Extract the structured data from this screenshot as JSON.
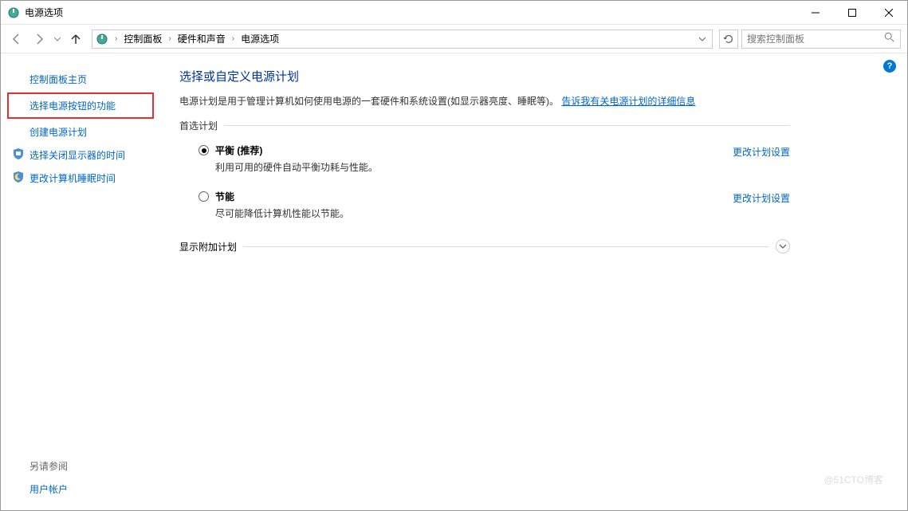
{
  "window": {
    "title": "电源选项"
  },
  "breadcrumb": {
    "items": [
      "控制面板",
      "硬件和声音",
      "电源选项"
    ]
  },
  "search": {
    "placeholder": "搜索控制面板"
  },
  "sidebar": {
    "items": [
      {
        "label": "控制面板主页",
        "icon": null,
        "highlighted": false
      },
      {
        "label": "选择电源按钮的功能",
        "icon": null,
        "highlighted": true
      },
      {
        "label": "创建电源计划",
        "icon": null,
        "highlighted": false
      },
      {
        "label": "选择关闭显示器的时间",
        "icon": "monitor",
        "highlighted": false
      },
      {
        "label": "更改计算机睡眠时间",
        "icon": "moon",
        "highlighted": false
      }
    ],
    "footer_label": "另请参阅",
    "footer_link": "用户帐户"
  },
  "main": {
    "heading": "选择或自定义电源计划",
    "desc_text": "电源计划是用于管理计算机如何使用电源的一套硬件和系统设置(如显示器亮度、睡眠等)。",
    "desc_link": "告诉我有关电源计划的详细信息",
    "preferred_label": "首选计划",
    "plans": [
      {
        "title": "平衡 (推荐)",
        "desc": "利用可用的硬件自动平衡功耗与性能。",
        "selected": true,
        "change_link": "更改计划设置"
      },
      {
        "title": "节能",
        "desc": "尽可能降低计算机性能以节能。",
        "selected": false,
        "change_link": "更改计划设置"
      }
    ],
    "additional_label": "显示附加计划"
  },
  "watermark": "@51CTO博客"
}
